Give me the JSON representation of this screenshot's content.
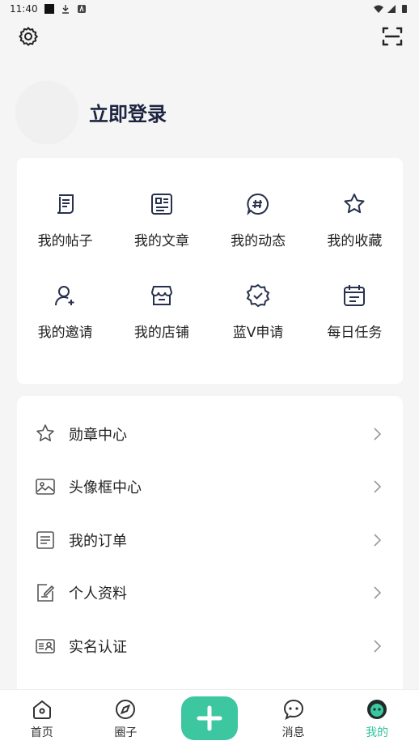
{
  "status": {
    "time": "11:40"
  },
  "profile": {
    "login_label": "立即登录"
  },
  "grid": {
    "items": [
      {
        "label": "我的帖子"
      },
      {
        "label": "我的文章"
      },
      {
        "label": "我的动态"
      },
      {
        "label": "我的收藏"
      },
      {
        "label": "我的邀请"
      },
      {
        "label": "我的店铺"
      },
      {
        "label": "蓝V申请"
      },
      {
        "label": "每日任务"
      }
    ]
  },
  "menu": {
    "items": [
      {
        "label": "勋章中心"
      },
      {
        "label": "头像框中心"
      },
      {
        "label": "我的订单"
      },
      {
        "label": "个人资料"
      },
      {
        "label": "实名认证"
      }
    ]
  },
  "tabs": [
    {
      "label": "首页"
    },
    {
      "label": "圈子"
    },
    {
      "label": ""
    },
    {
      "label": "消息"
    },
    {
      "label": "我的"
    }
  ],
  "colors": {
    "accent": "#3cc7a0",
    "title": "#1c2440"
  }
}
